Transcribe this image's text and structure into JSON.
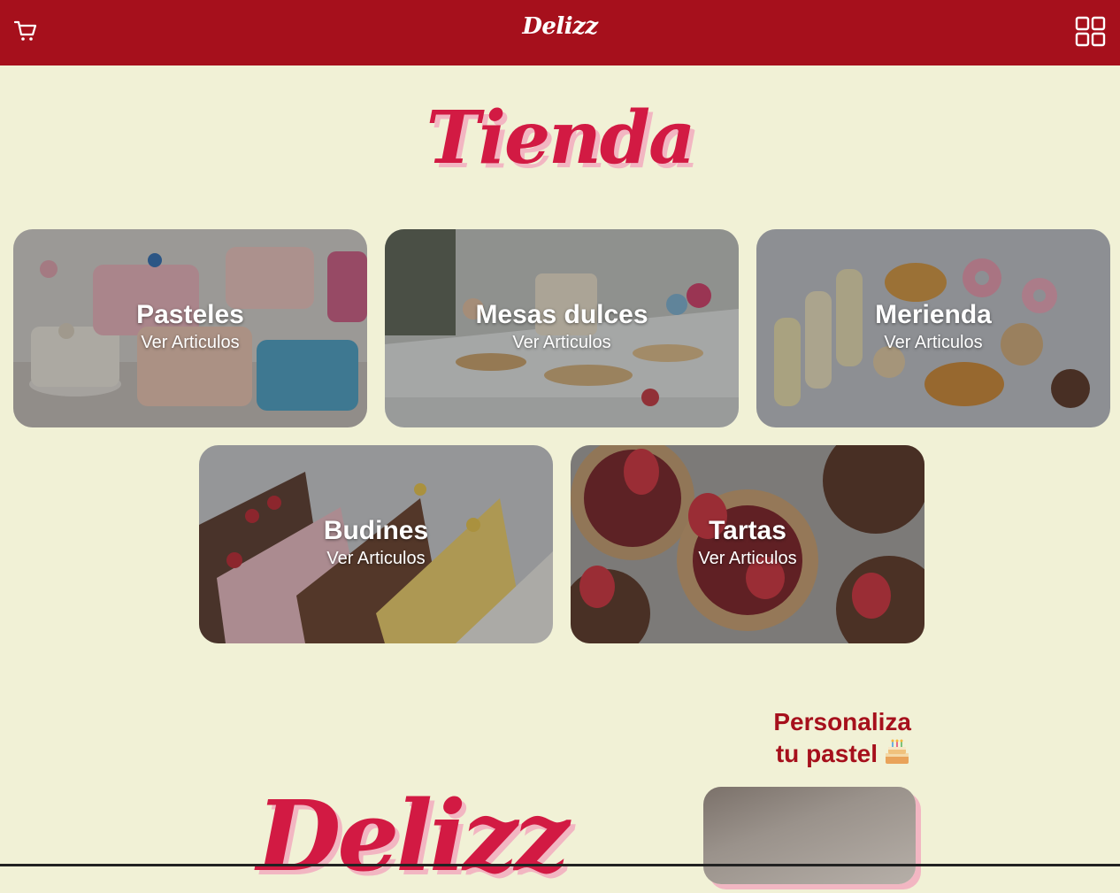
{
  "navbar": {
    "brand": "Delizz",
    "cart_icon": "cart-icon",
    "menu_icon": "grid-menu-icon",
    "background": "#a6101c"
  },
  "shop": {
    "title": "Tienda",
    "categories": [
      {
        "title": "Pasteles",
        "link": "Ver Articulos"
      },
      {
        "title": "Mesas dulces",
        "link": "Ver Articulos"
      },
      {
        "title": "Merienda",
        "link": "Ver Articulos"
      },
      {
        "title": "Budines",
        "link": "Ver Articulos"
      },
      {
        "title": "Tartas",
        "link": "Ver Articulos"
      }
    ]
  },
  "custom": {
    "line1": "Personaliza",
    "line2": "tu pastel",
    "emoji_icon": "birthday-cake-icon"
  },
  "footer_logo": "Delizz",
  "colors": {
    "page_bg": "#f1f1d6",
    "accent": "#d21a43",
    "accent_shadow": "#f2b6c2",
    "dark_red": "#a6101c"
  }
}
